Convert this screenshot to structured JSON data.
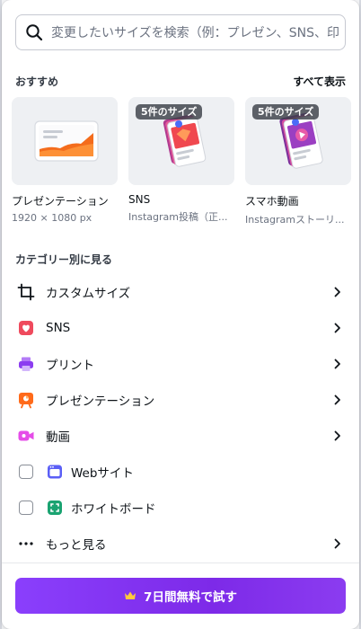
{
  "search": {
    "placeholder": "変更したいサイズを検索（例：プレゼン、SNS、印"
  },
  "recommended": {
    "title": "おすすめ",
    "show_all": "すべて表示",
    "cards": [
      {
        "name": "プレゼンテーション",
        "sub": "1920 × 1080 px",
        "badge": ""
      },
      {
        "name": "SNS",
        "sub": "Instagram投稿（正...",
        "badge": "5件のサイズ"
      },
      {
        "name": "スマホ動画",
        "sub": "Instagramストーリ...",
        "badge": "5件のサイズ"
      }
    ]
  },
  "categories": {
    "title": "カテゴリー別に見る",
    "items": [
      {
        "label": "カスタムサイズ",
        "icon": "crop-icon"
      },
      {
        "label": "SNS",
        "icon": "heart-icon"
      },
      {
        "label": "プリント",
        "icon": "printer-icon"
      },
      {
        "label": "プレゼンテーション",
        "icon": "presentation-icon"
      },
      {
        "label": "動画",
        "icon": "video-icon"
      },
      {
        "label": "Webサイト",
        "icon": "website-icon"
      },
      {
        "label": "ホワイトボード",
        "icon": "whiteboard-icon"
      },
      {
        "label": "もっと見る",
        "icon": "more-icon"
      }
    ]
  },
  "cta": {
    "label": "7日間無料で試す",
    "icon": "crown-icon"
  },
  "colors": {
    "accent": "#7d2ae8",
    "sns": "#ef4a5d",
    "print": "#8b3df0",
    "presentation": "#ff6a1a",
    "video": "#e54ce8",
    "website": "#5b5ff6",
    "whiteboard": "#1aa371"
  }
}
